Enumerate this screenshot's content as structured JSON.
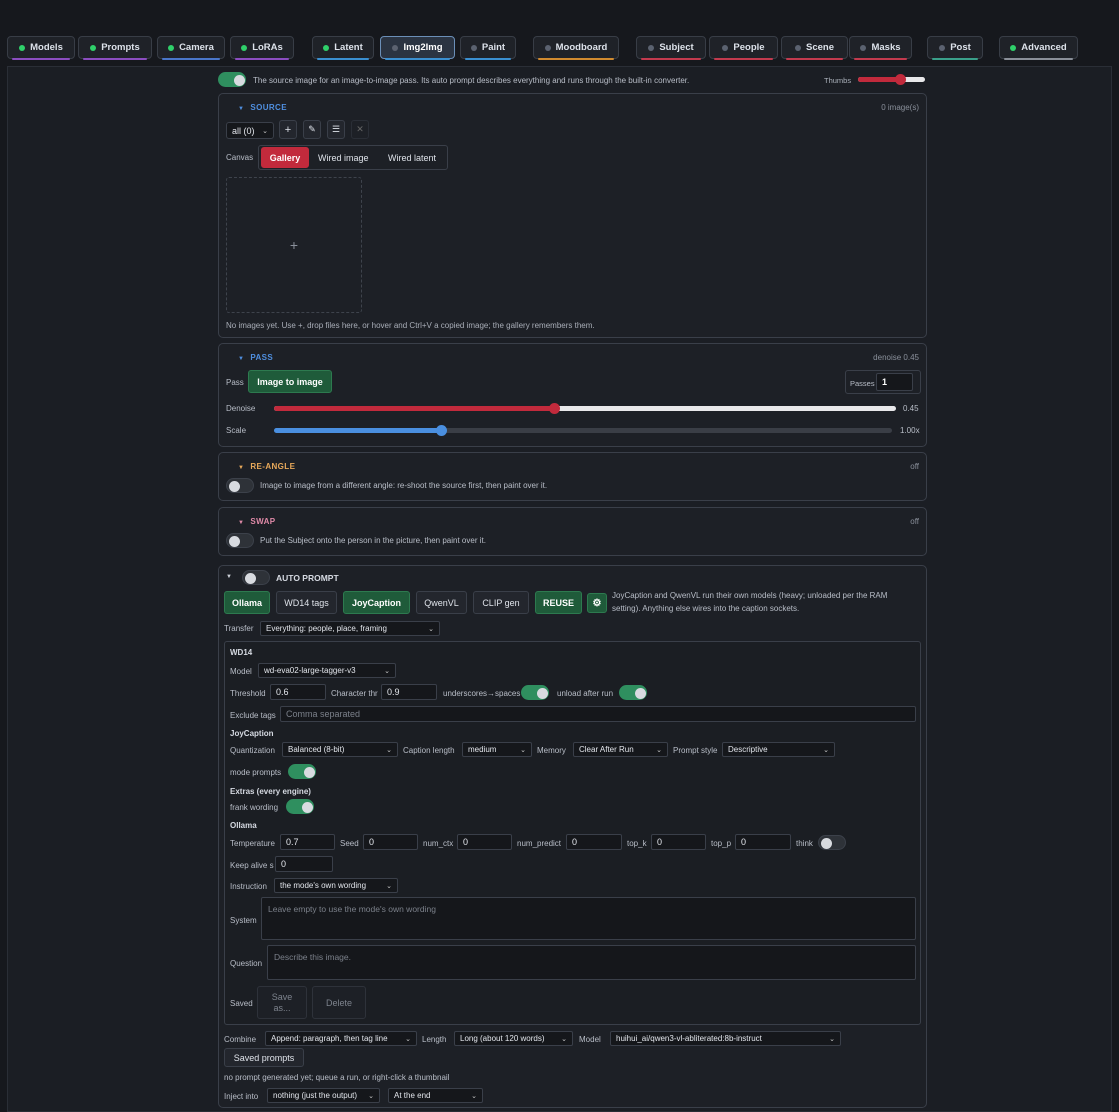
{
  "tabs": [
    {
      "label": "Models",
      "dot": "#2fd06a",
      "ul": "#8b4dc0",
      "active": false
    },
    {
      "label": "Prompts",
      "dot": "#2fd06a",
      "ul": "#8b4dc0",
      "active": false
    },
    {
      "label": "Camera",
      "dot": "#2fd06a",
      "ul": "#4a76c9",
      "active": false
    },
    {
      "label": "LoRAs",
      "dot": "#2fd06a",
      "ul": "#8b4dc0",
      "active": false
    },
    {
      "label": "Latent",
      "dot": "#2fd06a",
      "ul": "#3a8fd0",
      "active": false
    },
    {
      "label": "Img2Img",
      "dot": "#5b6270",
      "ul": "#3a8fd0",
      "active": true
    },
    {
      "label": "Paint",
      "dot": "#5b6270",
      "ul": "#3a8fd0",
      "active": false
    },
    {
      "label": "Moodboard",
      "dot": "#5b6270",
      "ul": "#d08a2f",
      "active": false
    },
    {
      "label": "Subject",
      "dot": "#5b6270",
      "ul": "#c23a4e",
      "active": false
    },
    {
      "label": "People",
      "dot": "#5b6270",
      "ul": "#c23a4e",
      "active": false
    },
    {
      "label": "Scene",
      "dot": "#5b6270",
      "ul": "#c23a4e",
      "active": false
    },
    {
      "label": "Masks",
      "dot": "#5b6270",
      "ul": "#c23a4e",
      "active": false
    },
    {
      "label": "Post",
      "dot": "#5b6270",
      "ul": "#3aa08a",
      "active": false
    },
    {
      "label": "Advanced",
      "dot": "#2fd06a",
      "ul": "#8a8f99",
      "active": false
    }
  ],
  "intro": {
    "text": "The source image for an image-to-image pass. Its auto prompt describes everything and runs through the built-in converter.",
    "thumbs_label": "Thumbs",
    "thumbs_value": 0.62
  },
  "source": {
    "title": "SOURCE",
    "count": "0 image(s)",
    "filter": "all (0)",
    "canvas_label": "Canvas",
    "canvas_options": [
      "Gallery",
      "Wired image",
      "Wired latent"
    ],
    "plus": "+",
    "empty": "No images yet. Use +, drop files here, or hover and Ctrl+V a copied image; the gallery remembers them."
  },
  "pass": {
    "title": "PASS",
    "status": "denoise 0.45",
    "pass_label": "Pass",
    "pass_button": "Image to image",
    "passes_label": "Passes",
    "passes_value": "1",
    "denoise_label": "Denoise",
    "denoise_value": "0.45",
    "denoise_fraction": 0.45,
    "scale_label": "Scale",
    "scale_value": "1.00x",
    "scale_fraction": 0.27
  },
  "reangle": {
    "title": "RE-ANGLE",
    "status": "off",
    "text": "Image to image from a different angle: re-shoot the source first, then paint over it."
  },
  "swap": {
    "title": "SWAP",
    "status": "off",
    "text": "Put the Subject onto the person in the picture, then paint over it."
  },
  "auto": {
    "title": "AUTO PROMPT",
    "engines": [
      "Ollama",
      "WD14 tags",
      "JoyCaption",
      "QwenVL",
      "CLIP gen",
      "REUSE"
    ],
    "gear": "⚙",
    "note_1": "JoyCaption and QwenVL run their own models (heavy; unloaded per the RAM",
    "note_2": "setting). Anything else wires into the caption sockets.",
    "transfer_label": "Transfer",
    "transfer_value": "Everything: people, place, framing",
    "wd14": {
      "title": "WD14",
      "model_label": "Model",
      "model_value": "wd-eva02-large-tagger-v3",
      "threshold_label": "Threshold",
      "threshold_value": "0.6",
      "char_label": "Character thr",
      "char_value": "0.9",
      "underscores_label": "underscores→spaces",
      "unload_label": "unload after run",
      "exclude_label": "Exclude tags",
      "exclude_placeholder": "Comma separated"
    },
    "joy": {
      "title": "JoyCaption",
      "quant_label": "Quantization",
      "quant_value": "Balanced (8-bit)",
      "length_label": "Caption length",
      "length_value": "medium",
      "memory_label": "Memory",
      "memory_value": "Clear After Run",
      "style_label": "Prompt style",
      "style_value": "Descriptive",
      "mode_label": "mode prompts"
    },
    "extras": {
      "title": "Extras (every engine)",
      "frank_label": "frank wording"
    },
    "ollama": {
      "title": "Ollama",
      "temp_label": "Temperature",
      "temp_value": "0.7",
      "seed_label": "Seed",
      "seed_value": "0",
      "numctx_label": "num_ctx",
      "numctx_value": "0",
      "numpred_label": "num_predict",
      "numpred_value": "0",
      "topk_label": "top_k",
      "topk_value": "0",
      "topp_label": "top_p",
      "topp_value": "0",
      "think_label": "think",
      "keep_label": "Keep alive s",
      "keep_value": "0",
      "instr_label": "Instruction",
      "instr_value": "the mode's own wording",
      "system_label": "System",
      "system_placeholder": "Leave empty to use the mode's own wording",
      "question_label": "Question",
      "question_placeholder": "Describe this image.",
      "saved_label": "Saved",
      "save_as": "Save as...",
      "delete": "Delete"
    },
    "combine_label": "Combine",
    "combine_value": "Append: paragraph, then tag line",
    "length_label": "Length",
    "length_value": "Long (about 120 words)",
    "model_label": "Model",
    "model_value": "huihui_ai/qwen3-vl-abliterated:8b-instruct",
    "saved_prompts": "Saved prompts",
    "status": "no prompt generated yet; queue a run, or right-click a thumbnail",
    "inject_label": "Inject into",
    "inject_value": "nothing (just the output)",
    "position_value": "At the end"
  },
  "colors": {
    "source": "#4f8fe0",
    "pass": "#4f8fe0",
    "reangle": "#e8a95a",
    "swap": "#e08aa8",
    "red": "#c22a3c",
    "blue": "#4a8fe0",
    "green": "#2f8f5f"
  }
}
